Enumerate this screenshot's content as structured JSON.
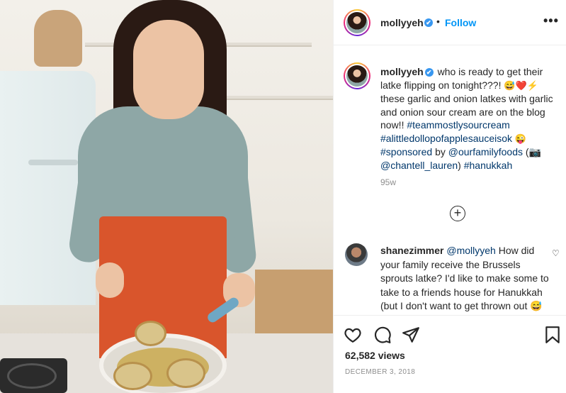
{
  "header": {
    "username": "mollyyeh",
    "verified_mark": "✔",
    "separator": "•",
    "follow_label": "Follow",
    "more_label": "•••"
  },
  "caption": {
    "username": "mollyyeh",
    "verified_mark": "✔",
    "text_1": "who is ready to get their latke flipping on tonight???!",
    "emoji_1": "😅❤️⚡",
    "text_2": "these garlic and onion latkes with garlic and onion sour cream are on the blog now!!",
    "tag_1": "#teammostlysourcream",
    "tag_2": "#alittledollopofapplesauceisok",
    "emoji_2": "😜",
    "tag_3": "#sponsored",
    "text_3": "by",
    "tag_4": "@ourfamilyfoods",
    "text_4": "(📷",
    "tag_5": "@chantell_lauren",
    "text_5": ")",
    "tag_6": "#hanukkah",
    "time_ago": "95w"
  },
  "load_more": {
    "label": "+"
  },
  "comment": {
    "username": "shanezimmer",
    "mention": "@mollyyeh",
    "text": "How did your family receive the Brussels sprouts latke? I'd like to make some to take to a friends house for Hanukkah (but I don't want to get thrown out 😅",
    "like_icon": "♡"
  },
  "actions": {
    "views": "62,582 views",
    "date": "DECEMBER 3, 2018"
  },
  "icons": {
    "like": "heart-icon",
    "comment": "comment-icon",
    "share": "share-icon",
    "save": "bookmark-icon"
  },
  "colors": {
    "follow": "#0095f6",
    "hashtag": "#00376b",
    "verified": "#3897f0",
    "muted": "#8e8e8e"
  }
}
